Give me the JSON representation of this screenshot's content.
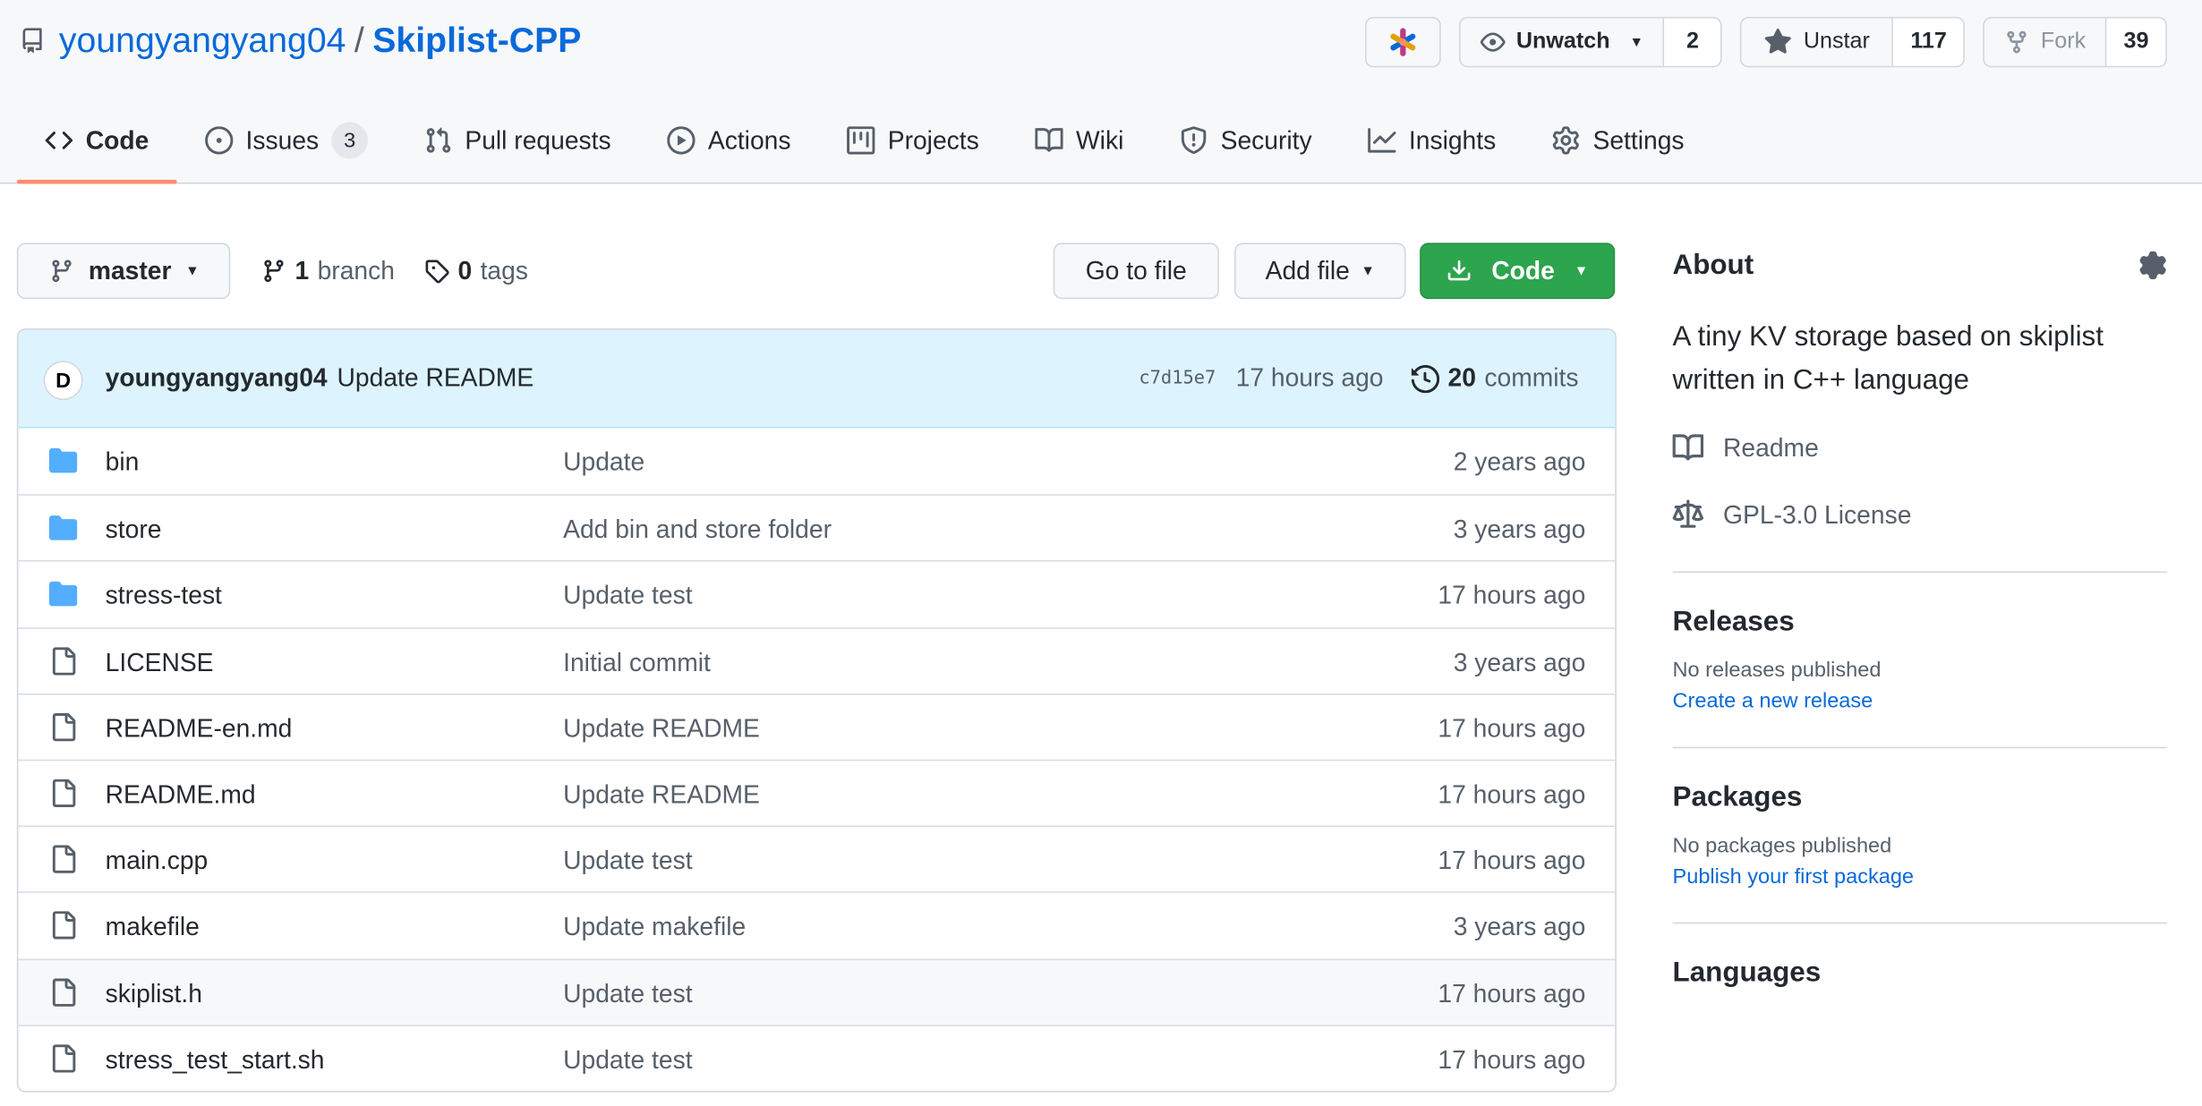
{
  "header": {
    "owner": "youngyangyang04",
    "separator": "/",
    "repo": "Skiplist-CPP",
    "watch": {
      "label": "Unwatch",
      "count": "2"
    },
    "star": {
      "label": "Unstar",
      "count": "117"
    },
    "fork": {
      "label": "Fork",
      "count": "39"
    }
  },
  "tabs": [
    {
      "label": "Code",
      "icon": "code-icon",
      "selected": true
    },
    {
      "label": "Issues",
      "icon": "issue-icon",
      "counter": "3"
    },
    {
      "label": "Pull requests",
      "icon": "pull-request-icon"
    },
    {
      "label": "Actions",
      "icon": "play-icon"
    },
    {
      "label": "Projects",
      "icon": "project-icon"
    },
    {
      "label": "Wiki",
      "icon": "book-icon"
    },
    {
      "label": "Security",
      "icon": "shield-icon"
    },
    {
      "label": "Insights",
      "icon": "graph-icon"
    },
    {
      "label": "Settings",
      "icon": "gear-icon"
    }
  ],
  "toolbar": {
    "branch": "master",
    "branch_count": "1",
    "branch_word": "branch",
    "tag_count": "0",
    "tag_word": "tags",
    "go_to_file": "Go to file",
    "add_file": "Add file",
    "code": "Code"
  },
  "commit": {
    "avatar_letter": "D",
    "author": "youngyangyang04",
    "message": "Update README",
    "sha": "c7d15e7",
    "time": "17 hours ago",
    "count": "20",
    "count_word": "commits"
  },
  "files": [
    {
      "type": "dir",
      "name": "bin",
      "message": "Update",
      "age": "2 years ago"
    },
    {
      "type": "dir",
      "name": "store",
      "message": "Add bin and store folder",
      "age": "3 years ago"
    },
    {
      "type": "dir",
      "name": "stress-test",
      "message": "Update test",
      "age": "17 hours ago"
    },
    {
      "type": "file",
      "name": "LICENSE",
      "message": "Initial commit",
      "age": "3 years ago"
    },
    {
      "type": "file",
      "name": "README-en.md",
      "message": "Update README",
      "age": "17 hours ago"
    },
    {
      "type": "file",
      "name": "README.md",
      "message": "Update README",
      "age": "17 hours ago"
    },
    {
      "type": "file",
      "name": "main.cpp",
      "message": "Update test",
      "age": "17 hours ago"
    },
    {
      "type": "file",
      "name": "makefile",
      "message": "Update makefile",
      "age": "3 years ago"
    },
    {
      "type": "file",
      "name": "skiplist.h",
      "message": "Update test",
      "age": "17 hours ago"
    },
    {
      "type": "file",
      "name": "stress_test_start.sh",
      "message": "Update test",
      "age": "17 hours ago"
    }
  ],
  "sidebar": {
    "about_title": "About",
    "description": "A tiny KV storage based on skiplist written in C++ language",
    "readme": "Readme",
    "license": "GPL-3.0 License",
    "releases_title": "Releases",
    "releases_none": "No releases published",
    "releases_link": "Create a new release",
    "packages_title": "Packages",
    "packages_none": "No packages published",
    "packages_link": "Publish your first package",
    "languages_title": "Languages"
  },
  "colors": {
    "link": "#0969da",
    "primary_button": "#2da44e",
    "tab_underline": "#fd8c73",
    "folder": "#54aeff"
  }
}
